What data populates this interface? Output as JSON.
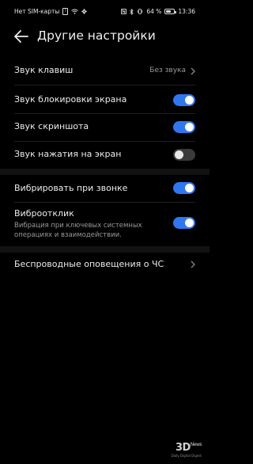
{
  "status_bar": {
    "carrier": "Нет SIM-карты",
    "battery_percent": "64 %",
    "battery_level": 0.64,
    "time": "13:36"
  },
  "header": {
    "title": "Другие настройки"
  },
  "settings": [
    {
      "label": "Звук клавиш",
      "value": "Без звука",
      "type": "link"
    },
    {
      "label": "Звук блокировки экрана",
      "type": "toggle",
      "on": true
    },
    {
      "label": "Звук скриншота",
      "type": "toggle",
      "on": true
    },
    {
      "label": "Звук нажатия на экран",
      "type": "toggle",
      "on": false
    },
    {
      "label": "Вибрировать при звонке",
      "type": "toggle",
      "on": true
    },
    {
      "label": "Виброотклик",
      "subtitle": "Вибрация при ключевых системных операциях и взаимодействии.",
      "type": "toggle",
      "on": true
    },
    {
      "label": "Беспроводные оповещения о ЧС",
      "type": "link"
    }
  ],
  "colors": {
    "accent": "#2f77f2",
    "background": "#000000"
  },
  "watermark": {
    "logo": "3D",
    "logo_suffix": "News",
    "tagline": "Daily Digital Digest"
  }
}
